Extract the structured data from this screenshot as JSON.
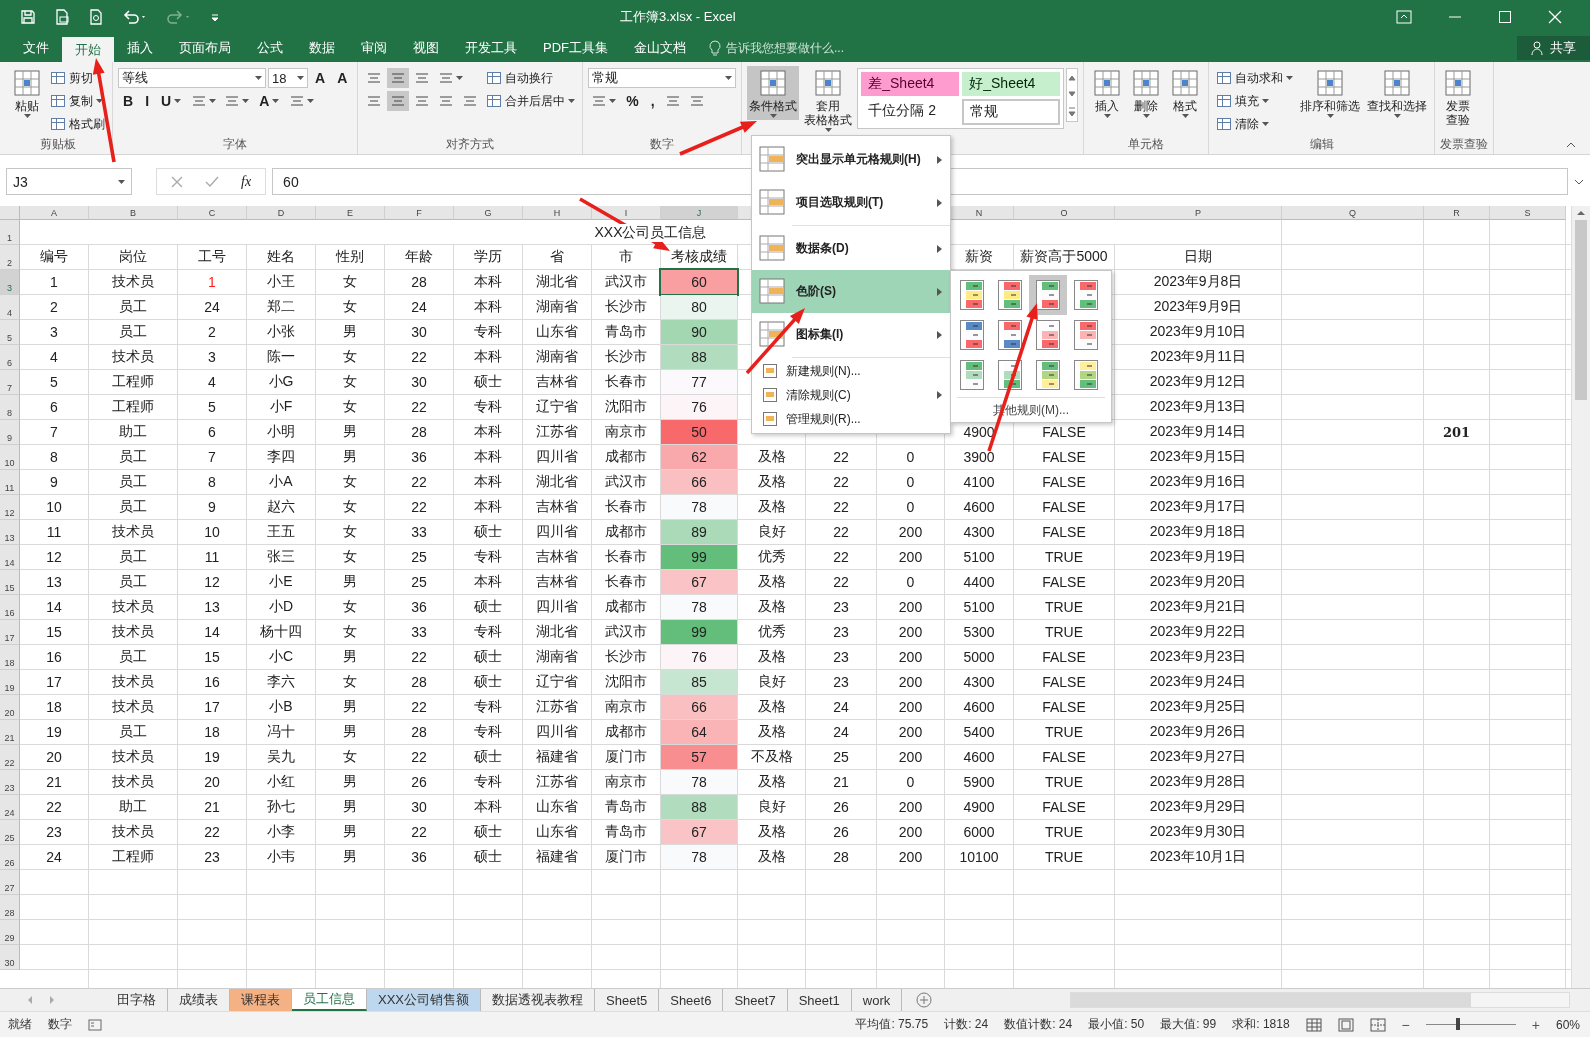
{
  "window": {
    "title": "工作簿3.xlsx - Excel"
  },
  "tabs": [
    {
      "label": "文件",
      "selected": false
    },
    {
      "label": "开始",
      "selected": true
    },
    {
      "label": "插入",
      "selected": false
    },
    {
      "label": "页面布局",
      "selected": false
    },
    {
      "label": "公式",
      "selected": false
    },
    {
      "label": "数据",
      "selected": false
    },
    {
      "label": "审阅",
      "selected": false
    },
    {
      "label": "视图",
      "selected": false
    },
    {
      "label": "开发工具",
      "selected": false
    },
    {
      "label": "PDF工具集",
      "selected": false
    },
    {
      "label": "金山文档",
      "selected": false
    }
  ],
  "tell_me": "告诉我您想要做什么...",
  "share": "共享",
  "ribbon": {
    "groups": [
      {
        "label": "剪贴板",
        "parts": [
          {
            "kind": "large",
            "label": "粘贴",
            "dropdown": true
          },
          {
            "kind": "stack",
            "lines": [
              [
                {
                  "kind": "small",
                  "label": "剪切"
                }
              ],
              [
                {
                  "kind": "small",
                  "label": "复制",
                  "dropdown": true
                }
              ],
              [
                {
                  "kind": "small",
                  "label": "格式刷"
                }
              ]
            ]
          }
        ]
      },
      {
        "label": "字体",
        "parts": [
          {
            "kind": "stack",
            "lines": [
              [
                {
                  "kind": "field",
                  "value": "等线"
                },
                {
                  "kind": "field",
                  "value": "18"
                },
                {
                  "kind": "glyph",
                  "label": "A"
                },
                {
                  "kind": "glyph",
                  "label": "A"
                }
              ],
              [
                {
                  "kind": "glyph",
                  "label": "B"
                },
                {
                  "kind": "glyph",
                  "label": "I"
                },
                {
                  "kind": "glyph",
                  "label": "U",
                  "dropdown": true
                },
                {
                  "kind": "icon",
                  "dropdown": true
                },
                {
                  "kind": "icon",
                  "dropdown": true
                },
                {
                  "kind": "glyph",
                  "label": "A",
                  "dropdown": true
                },
                {
                  "kind": "icon",
                  "dropdown": true
                }
              ]
            ]
          }
        ]
      },
      {
        "label": "对齐方式",
        "parts": [
          {
            "kind": "stack",
            "lines": [
              [
                {
                  "kind": "icon",
                  "on": false
                },
                {
                  "kind": "icon",
                  "on": true
                },
                {
                  "kind": "icon",
                  "on": false
                },
                {
                  "kind": "icon",
                  "dropdown": true
                }
              ],
              [
                {
                  "kind": "icon",
                  "on": false
                },
                {
                  "kind": "icon",
                  "on": true
                },
                {
                  "kind": "icon",
                  "on": false
                },
                {
                  "kind": "icon"
                },
                {
                  "kind": "icon"
                }
              ]
            ]
          },
          {
            "kind": "stack",
            "lines": [
              [
                {
                  "kind": "small",
                  "label": "自动换行"
                }
              ],
              [
                {
                  "kind": "small",
                  "label": "合并后居中",
                  "dropdown": true
                }
              ]
            ]
          }
        ]
      },
      {
        "label": "数字",
        "parts": [
          {
            "kind": "stack",
            "lines": [
              [
                {
                  "kind": "field",
                  "value": "常规"
                }
              ],
              [
                {
                  "kind": "icon",
                  "dropdown": true
                },
                {
                  "kind": "glyph",
                  "label": "%"
                },
                {
                  "kind": "glyph",
                  "label": ","
                },
                {
                  "kind": "icon"
                },
                {
                  "kind": "icon"
                }
              ]
            ]
          }
        ]
      },
      {
        "parts": [
          {
            "kind": "large",
            "label": "条件格式",
            "dropdown": true,
            "on": true
          },
          {
            "kind": "large",
            "label_lines": [
              "套用",
              "表格格式"
            ],
            "dropdown": true,
            "on": false
          },
          {
            "kind": "gallery",
            "styles": [
              {
                "label": "差_Sheet4",
                "color": "#ff9ccf",
                "selected": false
              },
              {
                "label": "好_Sheet4",
                "color": "#c6efce",
                "selected": false
              },
              {
                "label": "千位分隔 2",
                "selected": false
              },
              {
                "label": "常规",
                "selected": true
              }
            ]
          }
        ]
      },
      {
        "label": "单元格",
        "parts": [
          {
            "kind": "large",
            "label": "插入",
            "dropdown": true
          },
          {
            "kind": "large",
            "label": "删除",
            "dropdown": true
          },
          {
            "kind": "large",
            "label": "格式",
            "dropdown": true
          }
        ]
      },
      {
        "label": "编辑",
        "parts": [
          {
            "kind": "stack",
            "lines": [
              [
                {
                  "kind": "small",
                  "label": "自动求和",
                  "dropdown": true
                }
              ],
              [
                {
                  "kind": "small",
                  "label": "填充",
                  "dropdown": true
                }
              ],
              [
                {
                  "kind": "small",
                  "label": "清除",
                  "dropdown": true
                }
              ]
            ]
          },
          {
            "kind": "large",
            "label": "排序和筛选",
            "dropdown": true
          },
          {
            "kind": "large",
            "label": "查找和选择",
            "dropdown": true
          }
        ]
      },
      {
        "label": "发票查验",
        "parts": [
          {
            "kind": "large",
            "label_lines": [
              "发票",
              "查验"
            ]
          }
        ]
      }
    ]
  },
  "formula_bar": {
    "name_box": "J3",
    "fx": "fx",
    "value": "60"
  },
  "columns": [
    "A",
    "B",
    "C",
    "D",
    "E",
    "F",
    "G",
    "H",
    "I",
    "J",
    null,
    null,
    null,
    "N",
    "O",
    "P",
    "Q",
    "R",
    "S"
  ],
  "rows": [
    {
      "num": "1",
      "title": "XXX公司员工信息"
    },
    {
      "num": "2",
      "cells": [
        "编号",
        "岗位",
        "工号",
        "姓名",
        "性别",
        "年龄",
        "学历",
        "省",
        "市",
        "考核成绩",
        null,
        null,
        null,
        "薪资",
        "薪资高于5000",
        "日期"
      ]
    },
    {
      "num": "3",
      "color": "#f99fa1",
      "cells": [
        "1",
        "技术员",
        {
          "text": "1",
          "kind": "flagged"
        },
        "小王",
        "女",
        "28",
        "本科",
        "湖北省",
        "武汉市",
        "60",
        null,
        null,
        null,
        null,
        null,
        "2023年9月8日"
      ]
    },
    {
      "num": "4",
      "color": "#eaf5f0",
      "cells": [
        "2",
        "员工",
        "24",
        "郑二",
        "女",
        "24",
        "本科",
        "湖南省",
        "长沙市",
        "80",
        null,
        null,
        null,
        null,
        null,
        "2023年9月9日"
      ]
    },
    {
      "num": "5",
      "color": "#a3d7b2",
      "cells": [
        "3",
        "员工",
        "2",
        "小张",
        "男",
        "30",
        "专科",
        "山东省",
        "青岛市",
        "90",
        null,
        null,
        null,
        null,
        null,
        "2023年9月10日"
      ]
    },
    {
      "num": "6",
      "color": "#b1ddbe",
      "cells": [
        "4",
        "技术员",
        "3",
        "陈一",
        "女",
        "22",
        "本科",
        "湖南省",
        "长沙市",
        "88",
        null,
        null,
        null,
        null,
        null,
        "2023年9月11日"
      ]
    },
    {
      "num": "7",
      "color": "#fcf9fc",
      "cells": [
        "5",
        "工程师",
        "4",
        "小G",
        "女",
        "30",
        "硕士",
        "吉林省",
        "长春市",
        "77",
        null,
        null,
        null,
        null,
        null,
        "2023年9月12日"
      ]
    },
    {
      "num": "8",
      "color": "#fcf4f7",
      "cells": [
        "6",
        "工程师",
        "5",
        "小F",
        "女",
        "22",
        "专科",
        "辽宁省",
        "沈阳市",
        "76",
        null,
        null,
        null,
        null,
        null,
        "2023年9月13日"
      ]
    },
    {
      "num": "9",
      "color": "#f8696b",
      "cells": [
        "7",
        "助工",
        "6",
        "小明",
        "男",
        "28",
        "本科",
        "江苏省",
        "南京市",
        "50",
        null,
        null,
        null,
        "4900",
        "FALSE",
        "2023年9月14日",
        null,
        {
          "text": "201",
          "kind": "note"
        }
      ]
    },
    {
      "num": "10",
      "color": "#f9a9ac",
      "cells": [
        "8",
        "员工",
        "7",
        "李四",
        "男",
        "36",
        "本科",
        "四川省",
        "成都市",
        "62",
        "及格",
        "22",
        "0",
        "3900",
        "FALSE",
        "2023年9月15日"
      ]
    },
    {
      "num": "11",
      "color": "#fabfc1",
      "cells": [
        "9",
        "员工",
        "8",
        "小A",
        "女",
        "22",
        "本科",
        "湖北省",
        "武汉市",
        "66",
        "及格",
        "22",
        "0",
        "4100",
        "FALSE",
        "2023年9月16日"
      ]
    },
    {
      "num": "12",
      "color": "#f8fafc",
      "cells": [
        "10",
        "员工",
        "9",
        "赵六",
        "女",
        "22",
        "本科",
        "吉林省",
        "长春市",
        "78",
        "及格",
        "22",
        "0",
        "4600",
        "FALSE",
        "2023年9月17日"
      ]
    },
    {
      "num": "13",
      "color": "#aadab8",
      "cells": [
        "11",
        "技术员",
        "10",
        "王五",
        "女",
        "33",
        "硕士",
        "四川省",
        "成都市",
        "89",
        "良好",
        "22",
        "200",
        "4300",
        "FALSE",
        "2023年9月18日"
      ]
    },
    {
      "num": "14",
      "color": "#63be7b",
      "cells": [
        "12",
        "员工",
        "11",
        "张三",
        "女",
        "25",
        "专科",
        "吉林省",
        "长春市",
        "99",
        "优秀",
        "22",
        "200",
        "5100",
        "TRUE",
        "2023年9月19日"
      ]
    },
    {
      "num": "15",
      "color": "#fac4c6",
      "cells": [
        "13",
        "员工",
        "12",
        "小E",
        "男",
        "25",
        "本科",
        "吉林省",
        "长春市",
        "67",
        "及格",
        "22",
        "0",
        "4400",
        "FALSE",
        "2023年9月20日"
      ]
    },
    {
      "num": "16",
      "color": "#f8fafc",
      "cells": [
        "14",
        "技术员",
        "13",
        "小D",
        "女",
        "36",
        "硕士",
        "四川省",
        "成都市",
        "78",
        "及格",
        "23",
        "200",
        "5100",
        "TRUE",
        "2023年9月21日"
      ]
    },
    {
      "num": "17",
      "color": "#63be7b",
      "cells": [
        "15",
        "技术员",
        "14",
        "杨十四",
        "女",
        "33",
        "专科",
        "湖北省",
        "武汉市",
        "99",
        "优秀",
        "23",
        "200",
        "5300",
        "TRUE",
        "2023年9月22日"
      ]
    },
    {
      "num": "18",
      "color": "#fcf4f7",
      "cells": [
        "16",
        "员工",
        "15",
        "小C",
        "男",
        "22",
        "硕士",
        "湖南省",
        "长沙市",
        "76",
        "及格",
        "23",
        "200",
        "5000",
        "FALSE",
        "2023年9月23日"
      ]
    },
    {
      "num": "19",
      "color": "#c7e6d1",
      "cells": [
        "17",
        "技术员",
        "16",
        "李六",
        "女",
        "28",
        "硕士",
        "辽宁省",
        "沈阳市",
        "85",
        "良好",
        "23",
        "200",
        "4300",
        "FALSE",
        "2023年9月24日"
      ]
    },
    {
      "num": "20",
      "color": "#fabfc1",
      "cells": [
        "18",
        "技术员",
        "17",
        "小B",
        "男",
        "22",
        "专科",
        "江苏省",
        "南京市",
        "66",
        "及格",
        "24",
        "200",
        "4600",
        "FALSE",
        "2023年9月25日"
      ]
    },
    {
      "num": "21",
      "color": "#fab4b6",
      "cells": [
        "19",
        "员工",
        "18",
        "冯十",
        "男",
        "28",
        "专科",
        "四川省",
        "成都市",
        "64",
        "及格",
        "24",
        "200",
        "5400",
        "TRUE",
        "2023年9月26日"
      ]
    },
    {
      "num": "22",
      "color": "#f98e91",
      "cells": [
        "20",
        "技术员",
        "19",
        "吴九",
        "女",
        "22",
        "硕士",
        "福建省",
        "厦门市",
        "57",
        "不及格",
        "25",
        "200",
        "4600",
        "FALSE",
        "2023年9月27日"
      ]
    },
    {
      "num": "23",
      "color": "#f8fafc",
      "cells": [
        "21",
        "技术员",
        "20",
        "小红",
        "男",
        "26",
        "专科",
        "江苏省",
        "南京市",
        "78",
        "及格",
        "21",
        "0",
        "5900",
        "TRUE",
        "2023年9月28日"
      ]
    },
    {
      "num": "24",
      "color": "#b1ddbe",
      "cells": [
        "22",
        "助工",
        "21",
        "孙七",
        "男",
        "30",
        "本科",
        "山东省",
        "青岛市",
        "88",
        "良好",
        "26",
        "200",
        "4900",
        "FALSE",
        "2023年9月29日"
      ]
    },
    {
      "num": "25",
      "color": "#fac4c6",
      "cells": [
        "23",
        "技术员",
        "22",
        "小李",
        "男",
        "22",
        "硕士",
        "山东省",
        "青岛市",
        "67",
        "及格",
        "26",
        "200",
        "6000",
        "TRUE",
        "2023年9月30日"
      ]
    },
    {
      "num": "26",
      "color": "#f8fafc",
      "cells": [
        "24",
        "工程师",
        "23",
        "小韦",
        "男",
        "36",
        "硕士",
        "福建省",
        "厦门市",
        "78",
        "及格",
        "28",
        "200",
        "10100",
        "TRUE",
        "2023年10月1日"
      ]
    },
    {
      "num": "27"
    },
    {
      "num": "28"
    },
    {
      "num": "29"
    },
    {
      "num": "30"
    }
  ],
  "menu": {
    "items": [
      {
        "kind": "big",
        "label": "突出显示单元格规则(H)",
        "submenu": true,
        "selected": false
      },
      {
        "kind": "big",
        "label": "项目选取规则(T)",
        "submenu": true,
        "selected": false
      },
      {
        "kind": "big",
        "label": "数据条(D)",
        "submenu": true,
        "selected": false
      },
      {
        "kind": "big",
        "label": "色阶(S)",
        "submenu": true,
        "selected": true
      },
      {
        "kind": "big",
        "label": "图标集(I)",
        "submenu": true,
        "selected": false
      },
      {
        "kind": "small",
        "label": "新建规则(N)...",
        "submenu": false,
        "selected": false
      },
      {
        "kind": "small",
        "label": "清除规则(C)",
        "submenu": true,
        "selected": false
      },
      {
        "kind": "small",
        "label": "管理规则(R)...",
        "submenu": false,
        "selected": false
      }
    ]
  },
  "color_scales": {
    "swatches": [
      {
        "selected": false
      },
      {
        "selected": false
      },
      {
        "selected": true
      },
      {
        "selected": false
      },
      {
        "selected": false
      },
      {
        "selected": false
      },
      {
        "selected": false
      },
      {
        "selected": false
      },
      {
        "selected": false
      },
      {
        "selected": false
      },
      {
        "selected": false
      },
      {
        "selected": false
      }
    ],
    "footer": "其他规则(M)..."
  },
  "sheet_tabs": [
    {
      "label": "田字格",
      "selected": false
    },
    {
      "label": "成绩表",
      "selected": false
    },
    {
      "label": "课程表",
      "selected": false,
      "color": "#f4b183"
    },
    {
      "label": "员工信息",
      "selected": true
    },
    {
      "label": "XXX公司销售额",
      "selected": false,
      "color": "#bdd7ee"
    },
    {
      "label": "数据透视表教程",
      "selected": false
    },
    {
      "label": "Sheet5",
      "selected": false
    },
    {
      "label": "Sheet6",
      "selected": false
    },
    {
      "label": "Sheet7",
      "selected": false
    },
    {
      "label": "Sheet1",
      "selected": false
    },
    {
      "label": "work",
      "selected": false
    }
  ],
  "status_bar": {
    "left": [
      "就绪",
      "数字"
    ],
    "stats": [
      "平均值: 75.75",
      "计数: 24",
      "数值计数: 24",
      "最小值: 50",
      "最大值: 99",
      "求和: 1818"
    ],
    "zoom_out": "−",
    "zoom_slider": {
      "level": 0.36
    },
    "zoom_in": "+",
    "zoom": "60%"
  }
}
